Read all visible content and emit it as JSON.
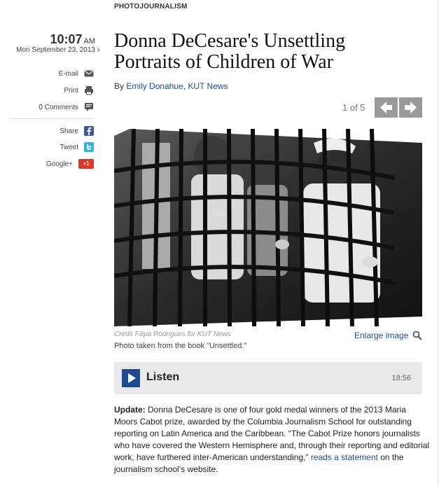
{
  "section": {
    "kicker": "PHOTOJOURNALISM"
  },
  "meta": {
    "time": "10:07",
    "ampm": "AM",
    "date": "Mon September 23, 2013"
  },
  "tools": {
    "email": "E-mail",
    "print": "Print",
    "comments": "0 Comments",
    "share": "Share",
    "tweet": "Tweet",
    "googleplus": "Google+",
    "googleplus_badge": "+1"
  },
  "article": {
    "title": "Donna DeCesare's Unsettling Portraits of Children of War",
    "by": "By",
    "author": "Emily Donahue",
    "outlet": "KUT News"
  },
  "gallery": {
    "position": "1 of 5",
    "credit": "Credit Filipa Rodrigues for KUT News",
    "caption": "Photo taken from the book \"Unsettled.\"",
    "enlarge": "Enlarge image"
  },
  "audio": {
    "label": "Listen",
    "duration": "18:56"
  },
  "body": {
    "update_label": "Update:",
    "text1": " Donna DeCesare is one of four gold medal winners of the 2013 Maria Moors Cabot prize, awarded by the Columbia Journalism School for outstanding reporting on Latin America and the Caribbean. “The Cabot Prize honors journalists who have covered the Western Hemisphere and, through their reporting and editorial work, have furthered inter-American understanding,” ",
    "link": "reads a statement",
    "text2": " on the journalism school’s website."
  }
}
